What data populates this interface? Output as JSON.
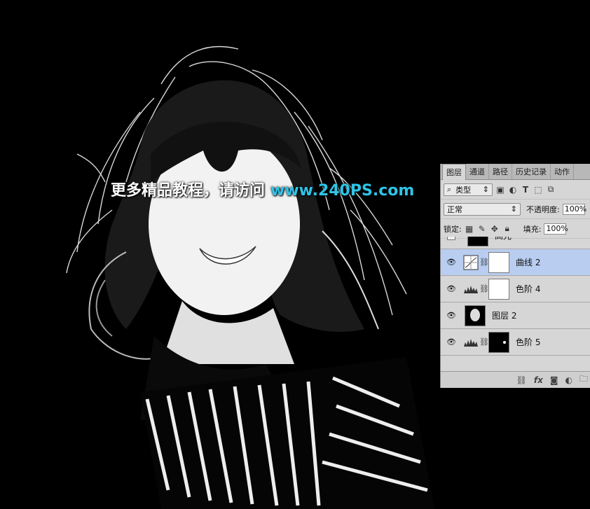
{
  "watermark": {
    "cn_text": "更多精品教程，请访问",
    "url": "www.240PS.com",
    "url_color": "#2fc4e8"
  },
  "panel": {
    "tabs": [
      "图层",
      "通道",
      "路径",
      "历史记录",
      "动作"
    ],
    "active_tab": "图层",
    "filter_kind": "类型",
    "blend_mode": "正常",
    "opacity_label": "不透明度:",
    "opacity_value": "100%",
    "lock_label": "锁定:",
    "fill_label": "填充:",
    "fill_value": "100%",
    "filter_icons": [
      "image-filter-icon",
      "adjustment-filter-icon",
      "type-filter-icon",
      "shape-filter-icon",
      "smart-object-filter-icon"
    ],
    "lock_icons": [
      "lock-transparent-icon",
      "lock-image-icon",
      "lock-position-icon",
      "lock-all-icon"
    ],
    "footer_icons": [
      "link-icon",
      "fx-icon",
      "mask-icon",
      "adjustment-layer-icon",
      "group-icon"
    ],
    "footer_fx_label": "fx",
    "selection_color": "#b8cdf0",
    "layers": [
      {
        "name": "高光",
        "visible": false,
        "type": "pixel"
      },
      {
        "name": "曲线 2",
        "visible": true,
        "type": "curves",
        "selected": true
      },
      {
        "name": "色阶 4",
        "visible": true,
        "type": "levels"
      },
      {
        "name": "图层 2",
        "visible": true,
        "type": "pixel"
      },
      {
        "name": "色阶 5",
        "visible": true,
        "type": "levels"
      }
    ]
  }
}
